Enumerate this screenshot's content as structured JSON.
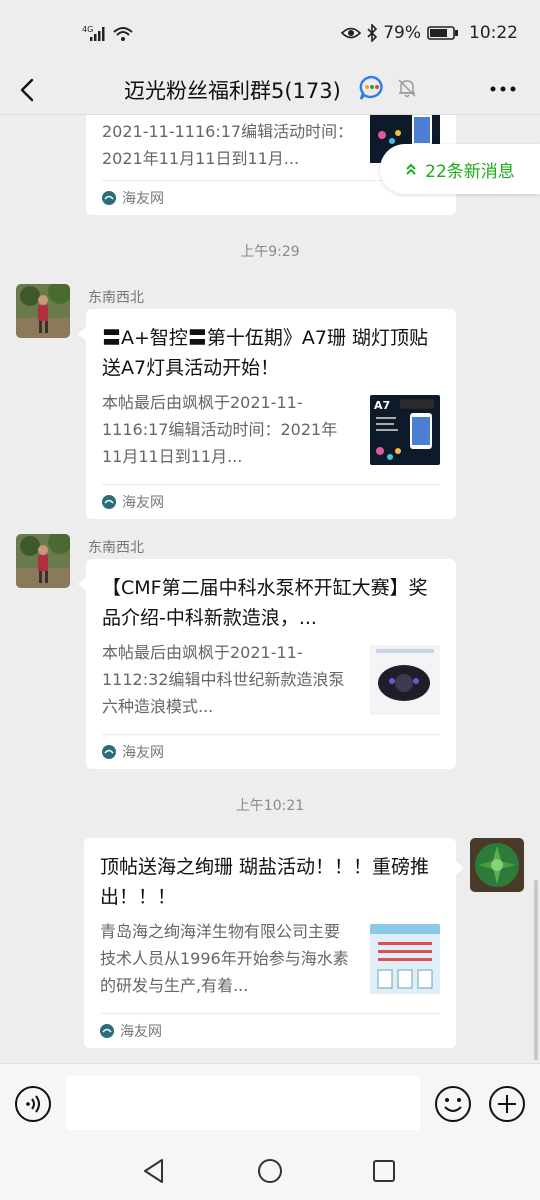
{
  "status": {
    "signal": "4G",
    "battery": "79%",
    "time": "10:22"
  },
  "header": {
    "title": "迈光粉丝福利群5(173)"
  },
  "new_messages": "22条新消息",
  "messages": [
    {
      "desc": "2021-11-1116:17编辑活动时间：2021年11月11日到11月...",
      "source": "海友网"
    },
    {
      "time": "上午9:29",
      "sender": "东南西北",
      "title": "〓A+智控〓第十伍期》A7珊 瑚灯顶贴送A7灯具活动开始！",
      "desc": "本帖最后由飒枫于2021-11-1116:17编辑活动时间：2021年11月11日到11月...",
      "thumb_label": "A7",
      "source": "海友网"
    },
    {
      "sender": "东南西北",
      "title": "【CMF第二届中科水泵杯开缸大赛】奖品介绍-中科新款造浪，...",
      "desc": "本帖最后由飒枫于2021-11-1112:32编辑中科世纪新款造浪泵六种造浪模式...",
      "source": "海友网"
    },
    {
      "time": "上午10:21",
      "title": "顶帖送海之绚珊 瑚盐活动！！！重磅推出！！！",
      "desc": "青岛海之绚海洋生物有限公司主要技术人员从1996年开始参与海水素的研发与生产,有着...",
      "source": "海友网"
    }
  ]
}
